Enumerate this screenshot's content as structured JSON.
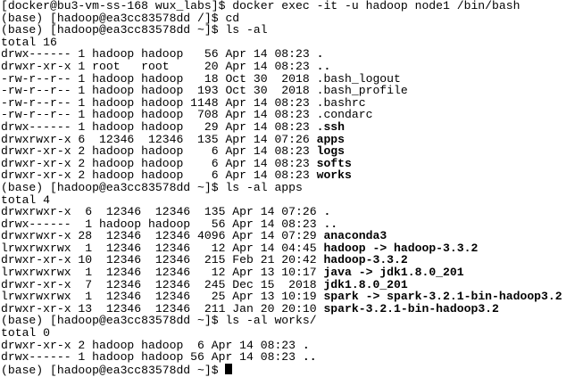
{
  "terminal": {
    "lines": [
      {
        "parts": [
          {
            "t": "[docker@bu3-vm-ss-168 wux_labs]$ docker exec -it -u hadoop node1 /bin/bash"
          }
        ]
      },
      {
        "parts": [
          {
            "t": "(base) [hadoop@ea3cc83578dd /]$ cd"
          }
        ]
      },
      {
        "parts": [
          {
            "t": "(base) [hadoop@ea3cc83578dd ~]$ ls -al"
          }
        ]
      },
      {
        "parts": [
          {
            "t": "total 16"
          }
        ]
      },
      {
        "parts": [
          {
            "t": "drwx------ 1 hadoop hadoop   56 Apr 14 08:23 "
          },
          {
            "t": ".",
            "b": true
          }
        ]
      },
      {
        "parts": [
          {
            "t": "drwxr-xr-x 1 root   root     20 Apr 14 08:23 "
          },
          {
            "t": "..",
            "b": true
          }
        ]
      },
      {
        "parts": [
          {
            "t": "-rw-r--r-- 1 hadoop hadoop   18 Oct 30  2018 .bash_logout"
          }
        ]
      },
      {
        "parts": [
          {
            "t": "-rw-r--r-- 1 hadoop hadoop  193 Oct 30  2018 .bash_profile"
          }
        ]
      },
      {
        "parts": [
          {
            "t": "-rw-r--r-- 1 hadoop hadoop 1148 Apr 14 08:23 .bashrc"
          }
        ]
      },
      {
        "parts": [
          {
            "t": "-rw-r--r-- 1 hadoop hadoop  708 Apr 14 08:23 .condarc"
          }
        ]
      },
      {
        "parts": [
          {
            "t": "drwx------ 1 hadoop hadoop   29 Apr 14 08:23 "
          },
          {
            "t": ".ssh",
            "b": true
          }
        ]
      },
      {
        "parts": [
          {
            "t": "drwxrwxr-x 6  12346  12346  135 Apr 14 07:26 "
          },
          {
            "t": "apps",
            "b": true
          }
        ]
      },
      {
        "parts": [
          {
            "t": "drwxr-xr-x 2 hadoop hadoop    6 Apr 14 08:23 "
          },
          {
            "t": "logs",
            "b": true
          }
        ]
      },
      {
        "parts": [
          {
            "t": "drwxr-xr-x 2 hadoop hadoop    6 Apr 14 08:23 "
          },
          {
            "t": "softs",
            "b": true
          }
        ]
      },
      {
        "parts": [
          {
            "t": "drwxr-xr-x 2 hadoop hadoop    6 Apr 14 08:23 "
          },
          {
            "t": "works",
            "b": true
          }
        ]
      },
      {
        "parts": [
          {
            "t": "(base) [hadoop@ea3cc83578dd ~]$ ls -al apps"
          }
        ]
      },
      {
        "parts": [
          {
            "t": "total 4"
          }
        ]
      },
      {
        "parts": [
          {
            "t": "drwxrwxr-x  6  12346  12346  135 Apr 14 07:26 "
          },
          {
            "t": ".",
            "b": true
          }
        ]
      },
      {
        "parts": [
          {
            "t": "drwx------  1 hadoop hadoop   56 Apr 14 08:23 "
          },
          {
            "t": "..",
            "b": true
          }
        ]
      },
      {
        "parts": [
          {
            "t": "drwxrwxr-x 28  12346  12346 4096 Apr 14 07:29 "
          },
          {
            "t": "anaconda3",
            "b": true
          }
        ]
      },
      {
        "parts": [
          {
            "t": "lrwxrwxrwx  1  12346  12346   12 Apr 14 04:45 "
          },
          {
            "t": "hadoop -> hadoop-3.3.2",
            "b": true
          }
        ]
      },
      {
        "parts": [
          {
            "t": "drwxr-xr-x 10  12346  12346  215 Feb 21 20:42 "
          },
          {
            "t": "hadoop-3.3.2",
            "b": true
          }
        ]
      },
      {
        "parts": [
          {
            "t": "lrwxrwxrwx  1  12346  12346   12 Apr 13 10:17 "
          },
          {
            "t": "java -> jdk1.8.0_201",
            "b": true
          }
        ]
      },
      {
        "parts": [
          {
            "t": "drwxr-xr-x  7  12346  12346  245 Dec 15  2018 "
          },
          {
            "t": "jdk1.8.0_201",
            "b": true
          }
        ]
      },
      {
        "parts": [
          {
            "t": "lrwxrwxrwx  1  12346  12346   25 Apr 13 10:19 "
          },
          {
            "t": "spark -> spark-3.2.1-bin-hadoop3.2",
            "b": true
          }
        ]
      },
      {
        "parts": [
          {
            "t": "drwxr-xr-x 13  12346  12346  211 Jan 20 20:10 "
          },
          {
            "t": "spark-3.2.1-bin-hadoop3.2",
            "b": true
          }
        ]
      },
      {
        "parts": [
          {
            "t": "(base) [hadoop@ea3cc83578dd ~]$ ls -al works/"
          }
        ]
      },
      {
        "parts": [
          {
            "t": "total 0"
          }
        ]
      },
      {
        "parts": [
          {
            "t": "drwxr-xr-x 2 hadoop hadoop  6 Apr 14 08:23 "
          },
          {
            "t": ".",
            "b": true
          }
        ]
      },
      {
        "parts": [
          {
            "t": "drwx------ 1 hadoop hadoop 56 Apr 14 08:23 "
          },
          {
            "t": "..",
            "b": true
          }
        ]
      },
      {
        "parts": [
          {
            "t": "(base) [hadoop@ea3cc83578dd ~]$ "
          }
        ],
        "cursor": true
      }
    ]
  }
}
